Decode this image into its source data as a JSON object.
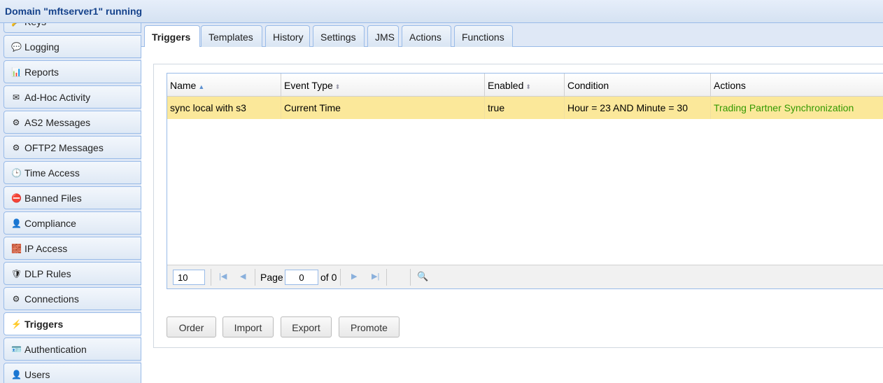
{
  "window": {
    "title": "Domain \"mftserver1\" running"
  },
  "sidebar": {
    "items": [
      {
        "label": "Keys",
        "icon": "key-icon"
      },
      {
        "label": "Logging",
        "icon": "speech-bubble-icon"
      },
      {
        "label": "Reports",
        "icon": "bar-chart-icon"
      },
      {
        "label": "Ad-Hoc Activity",
        "icon": "envelope-icon"
      },
      {
        "label": "AS2 Messages",
        "icon": "gears-icon"
      },
      {
        "label": "OFTP2 Messages",
        "icon": "gears-icon"
      },
      {
        "label": "Time Access",
        "icon": "clock-icon"
      },
      {
        "label": "Banned Files",
        "icon": "banned-file-icon"
      },
      {
        "label": "Compliance",
        "icon": "person-icon"
      },
      {
        "label": "IP Access",
        "icon": "firewall-icon"
      },
      {
        "label": "DLP Rules",
        "icon": "shield-icon"
      },
      {
        "label": "Connections",
        "icon": "gear-icon"
      },
      {
        "label": "Triggers",
        "icon": "trigger-icon",
        "active": true
      },
      {
        "label": "Authentication",
        "icon": "id-card-icon"
      },
      {
        "label": "Users",
        "icon": "user-icon"
      }
    ]
  },
  "tabs": [
    "Triggers",
    "Templates",
    "History",
    "Settings",
    "JMS",
    "Actions",
    "Functions"
  ],
  "grid": {
    "columns": [
      {
        "label": "Name",
        "sort": "asc"
      },
      {
        "label": "Event Type",
        "sort": "none"
      },
      {
        "label": "Enabled",
        "sort": "none"
      },
      {
        "label": "Condition"
      },
      {
        "label": "Actions"
      }
    ],
    "rows": [
      [
        "sync local with s3",
        "Current Time",
        "true",
        "Hour = 23 AND Minute = 30",
        "Trading Partner Synchronization"
      ]
    ],
    "action_color": "#339900",
    "selected_row_color": "#fbe89a"
  },
  "pager": {
    "page_size": "10",
    "page_label": "Page",
    "page": "0",
    "of_label": "of 0"
  },
  "buttons": [
    "Order",
    "Import",
    "Export",
    "Promote"
  ]
}
